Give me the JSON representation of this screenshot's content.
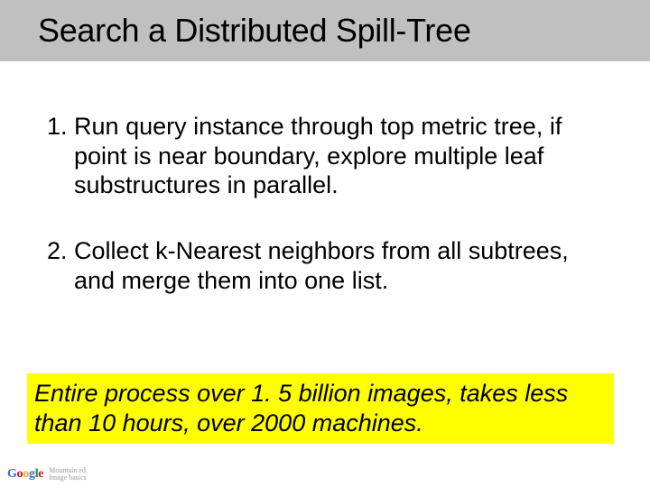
{
  "title": "Search a Distributed Spill-Tree",
  "points": [
    {
      "num": "1.",
      "text": "Run query instance through top metric tree, if point is near boundary, explore multiple leaf substructures in parallel."
    },
    {
      "num": "2.",
      "text": "Collect k-Nearest neighbors from all subtrees, and merge them into one list."
    }
  ],
  "highlight": "Entire process over 1. 5 billion images, takes less than 10 hours, over 2000 machines.",
  "logo": {
    "g1": "G",
    "g2": "o",
    "g3": "o",
    "g4": "g",
    "g5": "l",
    "g6": "e",
    "sub1": "Mountain ed.",
    "sub2": "Image basics"
  }
}
